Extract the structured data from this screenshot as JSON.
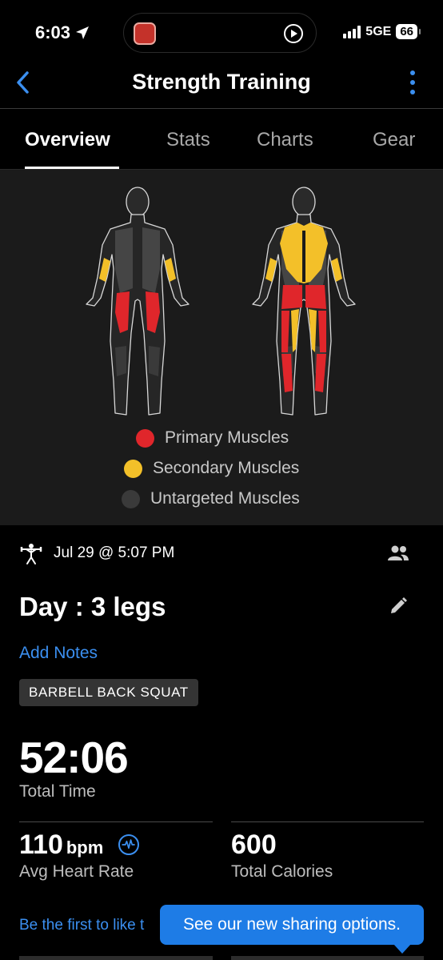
{
  "status_bar": {
    "time": "6:03",
    "network": "5GE",
    "battery": "66"
  },
  "nav": {
    "title": "Strength Training"
  },
  "tabs": [
    {
      "label": "Overview",
      "active": true
    },
    {
      "label": "Stats",
      "active": false
    },
    {
      "label": "Charts",
      "active": false
    },
    {
      "label": "Gear",
      "active": false
    }
  ],
  "colors": {
    "primary": "#e0262b",
    "secondary": "#f3c029",
    "untargeted": "#3a3a3a",
    "accent": "#3b8ff0",
    "tooltip": "#1e7ce6"
  },
  "legend": {
    "primary": "Primary Muscles",
    "secondary": "Secondary Muscles",
    "untargeted": "Untargeted Muscles"
  },
  "activity": {
    "date": "Jul 29 @ 5:07 PM",
    "name": "Day : 3 legs",
    "add_notes": "Add Notes",
    "exercise_tag": "BARBELL BACK SQUAT"
  },
  "stats": {
    "total_time": {
      "value": "52:06",
      "label": "Total Time"
    },
    "avg_heart_rate": {
      "value": "110",
      "unit": "bpm",
      "label": "Avg Heart Rate"
    },
    "total_calories": {
      "value": "600",
      "label": "Total Calories"
    }
  },
  "social": {
    "like_prompt": "Be the first to like t",
    "tooltip": "See our new sharing options."
  },
  "icons": [
    "location-arrow-icon",
    "play-circle-icon",
    "back-chevron-icon",
    "more-vertical-icon",
    "lifter-icon",
    "people-icon",
    "edit-pencil-icon",
    "heart-rate-icon"
  ]
}
